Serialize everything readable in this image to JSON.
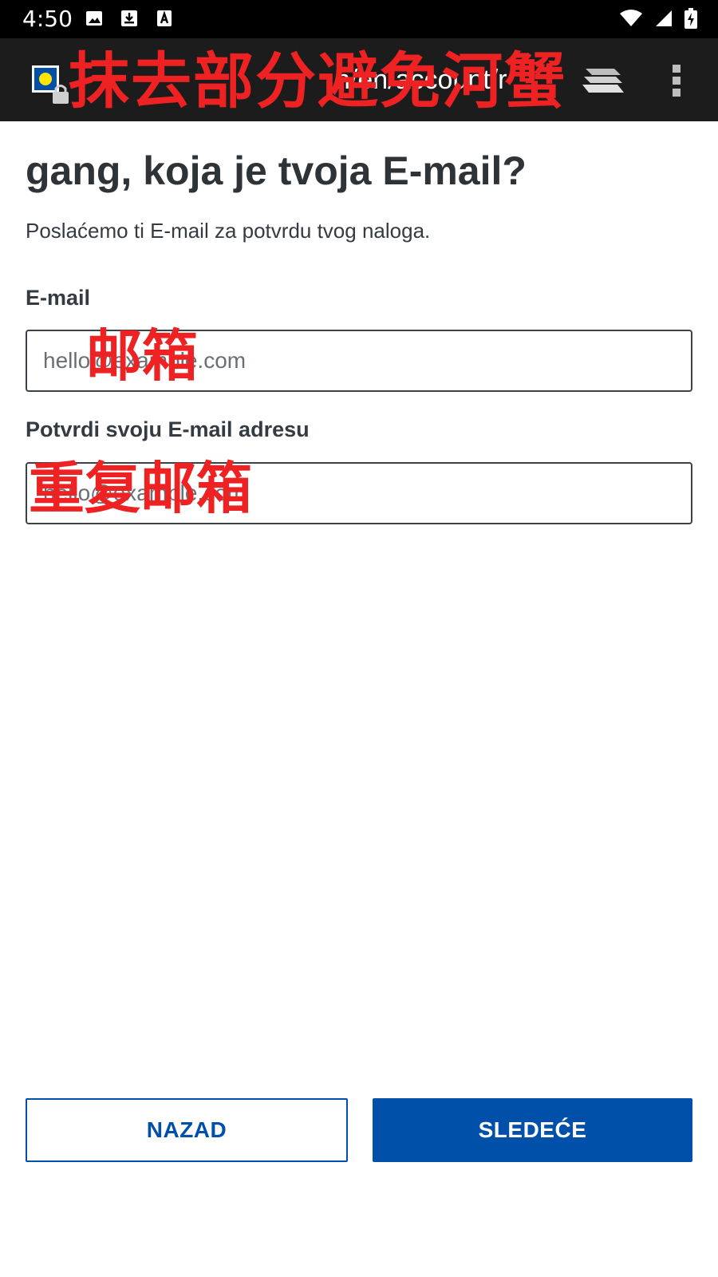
{
  "status_bar": {
    "time": "4:50",
    "left_icons": [
      "image-icon",
      "download-icon",
      "text-a-icon"
    ],
    "right_icons": [
      "wifi-icon",
      "signal-icon",
      "battery-charging-icon"
    ]
  },
  "browser": {
    "url_fragment": "n/en/account/r",
    "censor_text": "抹去部分避免河蟹",
    "icons": [
      "site-favicon",
      "lock-icon",
      "tabs-icon",
      "more-menu-icon"
    ]
  },
  "form": {
    "title": "gang, koja je tvoja E-mail?",
    "subtitle": "Poslaćemo ti E-mail za potvrdu tvog naloga.",
    "email_label": "E-mail",
    "email_placeholder": "hello@example.com",
    "email_value": "",
    "email_annotation": "邮箱",
    "confirm_label": "Potvrdi svoju E-mail adresu",
    "confirm_placeholder": "hello@example.com",
    "confirm_value": "",
    "confirm_annotation": "重复邮箱"
  },
  "buttons": {
    "back_label": "NAZAD",
    "next_label": "SLEDEĆE"
  },
  "colors": {
    "brand_blue": "#0050aa",
    "text_dark": "#2e3338",
    "annotation_red": "#ee2222"
  }
}
